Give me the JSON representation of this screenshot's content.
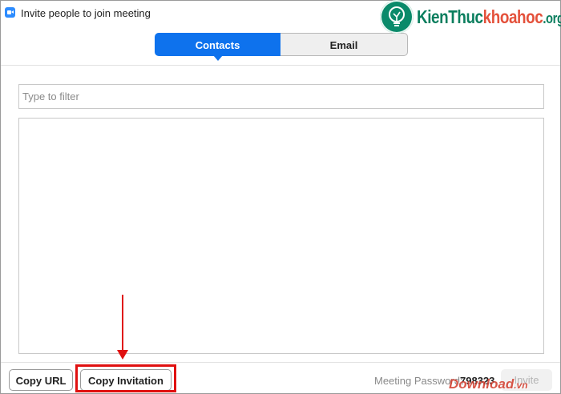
{
  "window": {
    "title": "Invite people to join meeting"
  },
  "watermark": {
    "part1": "KienThuc",
    "part2": "khoahoc",
    "part3": ".org",
    "download": "Download",
    "download_tld": ".vn"
  },
  "tabs": [
    {
      "label": "Contacts",
      "active": true
    },
    {
      "label": "Email",
      "active": false
    }
  ],
  "filter": {
    "placeholder": "Type to filter",
    "value": ""
  },
  "footer": {
    "copy_url_label": "Copy URL",
    "copy_invitation_label": "Copy Invitation",
    "password_label": "Meeting Password:",
    "password_value": "798323",
    "invite_label": "Invite"
  },
  "colors": {
    "accent": "#0e72ed",
    "highlight": "#e01010",
    "watermark_green": "#0a7e5e",
    "watermark_red": "#e4513b"
  }
}
